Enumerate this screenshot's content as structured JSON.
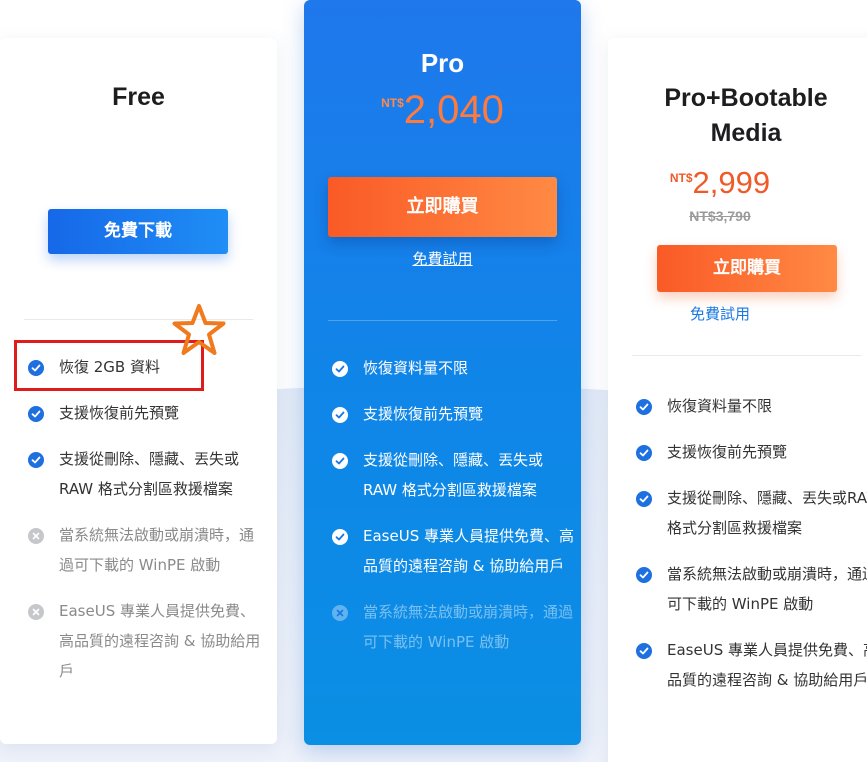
{
  "plans": {
    "free": {
      "title": "Free",
      "button_label": "免費下載",
      "features": [
        {
          "text": "恢復 2GB 資料",
          "included": true
        },
        {
          "text": "支援恢復前先預覽",
          "included": true
        },
        {
          "text": "支援從刪除、隱藏、丟失或RAW 格式分割區救援檔案",
          "included": true
        },
        {
          "text": "當系統無法啟動或崩潰時，通過可下載的 WinPE 啟動",
          "included": false
        },
        {
          "text": "EaseUS 專業人員提供免費、高品質的遠程咨詢 & 協助給用戶",
          "included": false
        }
      ]
    },
    "pro": {
      "title": "Pro",
      "currency": "NT$",
      "price": "2,040",
      "button_label": "立即購買",
      "trial_label": "免費試用",
      "features": [
        {
          "text": "恢復資料量不限",
          "included": true
        },
        {
          "text": "支援恢復前先預覽",
          "included": true
        },
        {
          "text": "支援從刪除、隱藏、丟失或RAW 格式分割區救援檔案",
          "included": true
        },
        {
          "text": "EaseUS 專業人員提供免費、高品質的遠程咨詢 & 協助給用戶",
          "included": true
        },
        {
          "text": "當系統無法啟動或崩潰時，通過可下載的 WinPE 啟動",
          "included": false
        }
      ]
    },
    "bootable": {
      "title": "Pro+Bootable Media",
      "currency": "NT$",
      "price": "2,999",
      "original_price": "NT$3,790",
      "button_label": "立即購買",
      "trial_label": "免費試用",
      "features": [
        {
          "text": "恢復資料量不限",
          "included": true
        },
        {
          "text": "支援恢復前先預覽",
          "included": true
        },
        {
          "text": "支援從刪除、隱藏、丟失或RAW 格式分割區救援檔案",
          "included": true
        },
        {
          "text": "當系統無法啟動或崩潰時，通過可下載的 WinPE 啟動",
          "included": true
        },
        {
          "text": "EaseUS 專業人員提供免費、高品質的遠程咨詢 & 協助給用戶",
          "included": true
        }
      ]
    }
  },
  "colors": {
    "accent_blue": "#1e6fe0",
    "accent_orange": "#fa5a26",
    "highlight_red": "#e01b1b",
    "star_orange": "#f07a1e"
  },
  "icons": {
    "included": "check-circle-icon",
    "excluded": "cross-circle-icon",
    "annotation": "star-icon"
  }
}
